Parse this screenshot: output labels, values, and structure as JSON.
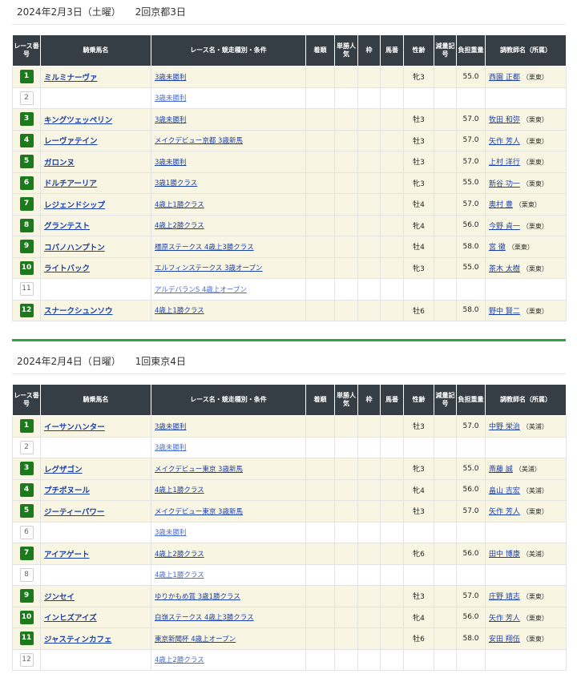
{
  "header": {
    "num": "レース番号",
    "horse": "騎乗馬名",
    "race": "レース名・競走種別・条件",
    "finish": "着順",
    "pop": "単勝人気",
    "frame": "枠",
    "horseno": "馬番",
    "sexage": "性齢",
    "reduce": "減量記号",
    "weight": "負担重量",
    "trainer": "調教師名（所属）"
  },
  "days": [
    {
      "date": "2024年2月3日（土曜）",
      "meet": "2回京都3日",
      "races": [
        {
          "num": "1",
          "active": true,
          "horse": "ミルミナーヴァ",
          "race": "3歳未勝利",
          "sexage": "牝3",
          "weight": "55.0",
          "trainer": "西園 正都",
          "aff": "（栗東）"
        },
        {
          "num": "2",
          "active": false,
          "horse": "",
          "race": "3歳未勝利",
          "sexage": "",
          "weight": "",
          "trainer": "",
          "aff": ""
        },
        {
          "num": "3",
          "active": true,
          "horse": "キングツェッペリン",
          "race": "3歳未勝利",
          "sexage": "牡3",
          "weight": "57.0",
          "trainer": "牧田 和弥",
          "aff": "（栗東）"
        },
        {
          "num": "4",
          "active": true,
          "horse": "レーヴァテイン",
          "race": "メイクデビュー京都 3歳新馬",
          "sexage": "牡3",
          "weight": "57.0",
          "trainer": "矢作 芳人",
          "aff": "（栗東）"
        },
        {
          "num": "5",
          "active": true,
          "horse": "ガロンヌ",
          "race": "3歳未勝利",
          "sexage": "牡3",
          "weight": "57.0",
          "trainer": "上村 洋行",
          "aff": "（栗東）"
        },
        {
          "num": "6",
          "active": true,
          "horse": "ドルチアーリア",
          "race": "3歳1勝クラス",
          "sexage": "牝3",
          "weight": "55.0",
          "trainer": "新谷 功一",
          "aff": "（栗東）"
        },
        {
          "num": "7",
          "active": true,
          "horse": "レジェンドシップ",
          "race": "4歳上1勝クラス",
          "sexage": "牡4",
          "weight": "57.0",
          "trainer": "奥村 豊",
          "aff": "（栗東）"
        },
        {
          "num": "8",
          "active": true,
          "horse": "グランテスト",
          "race": "4歳上2勝クラス",
          "sexage": "牝4",
          "weight": "56.0",
          "trainer": "今野 貞一",
          "aff": "（栗東）"
        },
        {
          "num": "9",
          "active": true,
          "horse": "コパノハンプトン",
          "race": "橿原ステークス 4歳上3勝クラス",
          "sexage": "牡4",
          "weight": "58.0",
          "trainer": "宮 徹",
          "aff": "（栗東）"
        },
        {
          "num": "10",
          "active": true,
          "horse": "ライトバック",
          "race": "エルフィンステークス 3歳オープン",
          "sexage": "牝3",
          "weight": "55.0",
          "trainer": "茶木 太樹",
          "aff": "（栗東）"
        },
        {
          "num": "11",
          "active": false,
          "horse": "",
          "race": "アルデバランS 4歳上オープン",
          "sexage": "",
          "weight": "",
          "trainer": "",
          "aff": ""
        },
        {
          "num": "12",
          "active": true,
          "horse": "スナークシュンソウ",
          "race": "4歳上1勝クラス",
          "sexage": "牡6",
          "weight": "58.0",
          "trainer": "野中 賢二",
          "aff": "（栗東）"
        }
      ]
    },
    {
      "date": "2024年2月4日（日曜）",
      "meet": "1回東京4日",
      "races": [
        {
          "num": "1",
          "active": true,
          "horse": "イーサンハンター",
          "race": "3歳未勝利",
          "sexage": "牡3",
          "weight": "57.0",
          "trainer": "中野 栄治",
          "aff": "（美浦）"
        },
        {
          "num": "2",
          "active": false,
          "horse": "",
          "race": "3歳未勝利",
          "sexage": "",
          "weight": "",
          "trainer": "",
          "aff": ""
        },
        {
          "num": "3",
          "active": true,
          "horse": "レグザゴン",
          "race": "メイクデビュー東京 3歳新馬",
          "sexage": "牝3",
          "weight": "55.0",
          "trainer": "斎藤 誠",
          "aff": "（美浦）"
        },
        {
          "num": "4",
          "active": true,
          "horse": "プチポヌール",
          "race": "4歳上1勝クラス",
          "sexage": "牝4",
          "weight": "56.0",
          "trainer": "畠山 吉宏",
          "aff": "（美浦）"
        },
        {
          "num": "5",
          "active": true,
          "horse": "ジーティーパワー",
          "race": "メイクデビュー東京 3歳新馬",
          "sexage": "牡3",
          "weight": "57.0",
          "trainer": "矢作 芳人",
          "aff": "（栗東）"
        },
        {
          "num": "6",
          "active": false,
          "horse": "",
          "race": "3歳未勝利",
          "sexage": "",
          "weight": "",
          "trainer": "",
          "aff": ""
        },
        {
          "num": "7",
          "active": true,
          "horse": "アイアゲート",
          "race": "4歳上2勝クラス",
          "sexage": "牝6",
          "weight": "56.0",
          "trainer": "田中 博康",
          "aff": "（美浦）"
        },
        {
          "num": "8",
          "active": false,
          "horse": "",
          "race": "4歳上1勝クラス",
          "sexage": "",
          "weight": "",
          "trainer": "",
          "aff": ""
        },
        {
          "num": "9",
          "active": true,
          "horse": "ジンセイ",
          "race": "ゆりかもめ賞 3歳1勝クラス",
          "sexage": "牡3",
          "weight": "57.0",
          "trainer": "庄野 靖志",
          "aff": "（栗東）"
        },
        {
          "num": "10",
          "active": true,
          "horse": "インヒズアイズ",
          "race": "白嶺ステークス 4歳上3勝クラス",
          "sexage": "牝4",
          "weight": "56.0",
          "trainer": "矢作 芳人",
          "aff": "（栗東）"
        },
        {
          "num": "11",
          "active": true,
          "horse": "ジャスティンカフェ",
          "race": "東京新聞杯 4歳上オープン",
          "sexage": "牡6",
          "weight": "58.0",
          "trainer": "安田 翔伍",
          "aff": "（栗東）"
        },
        {
          "num": "12",
          "active": false,
          "horse": "",
          "race": "4歳上2勝クラス",
          "sexage": "",
          "weight": "",
          "trainer": "",
          "aff": ""
        }
      ]
    }
  ]
}
